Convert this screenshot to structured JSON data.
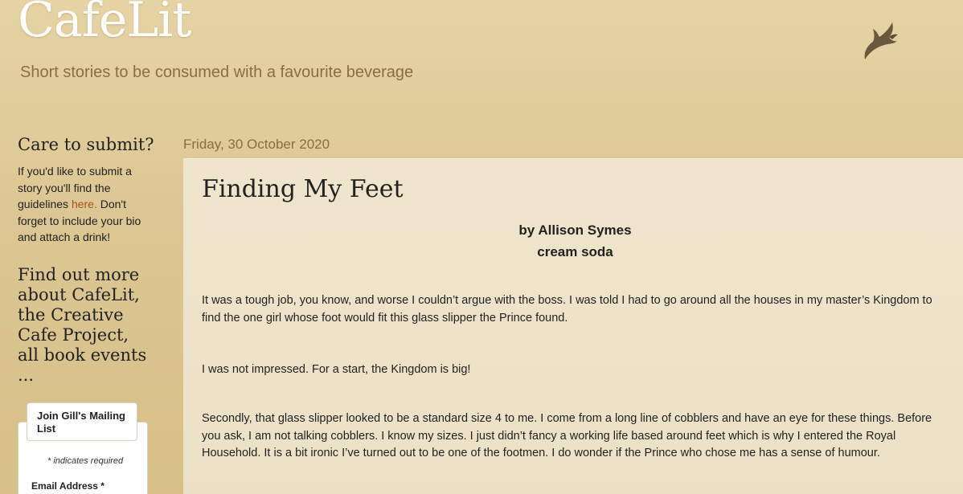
{
  "header": {
    "title": "CafeLit",
    "description": "Short stories to be consumed with a favourite beverage",
    "icon": "bird-icon"
  },
  "sidebar": {
    "submit_heading": "Care to submit?",
    "submit_text_before": "If you'd like to submit a story you'll find the guidelines ",
    "submit_link": "here.",
    "submit_text_after": " Don't forget to include your bio and attach a drink!",
    "more_heading": "Find out more about CafeLit, the Creative Cafe Project, all book events ...",
    "mailing": {
      "tab_label": "Join Gill's Mailing List",
      "required_note": "* indicates required",
      "email_label": "Email Address *"
    }
  },
  "post": {
    "date": "Friday, 30 October 2020",
    "title": "Finding My Feet",
    "author": "by Allison Symes",
    "drink": "cream soda",
    "paragraphs": [
      "It was a tough job, you know, and worse I couldn’t argue with the boss. I was told I had to go around all the houses in my master’s Kingdom to find the one girl whose foot would fit this glass slipper the Prince found.",
      "I was not impressed. For a start, the Kingdom is big!",
      "Secondly, that glass slipper looked to be a standard size 4 to me. I come from a long line of cobblers and have an eye for these things. Before you ask, I am not talking cobblers.  I know my sizes. I just didn’t fancy a working life based around feet which is why I entered the Royal Household. It is a bit ironic I’ve turned out to be one of the footmen. I do wonder if the Prince who chose me has a sense of humour."
    ]
  },
  "colors": {
    "background": "#dcc693",
    "accent_link": "#a8531a",
    "muted_text": "#8a6d47",
    "post_background": "#ece1c6"
  }
}
